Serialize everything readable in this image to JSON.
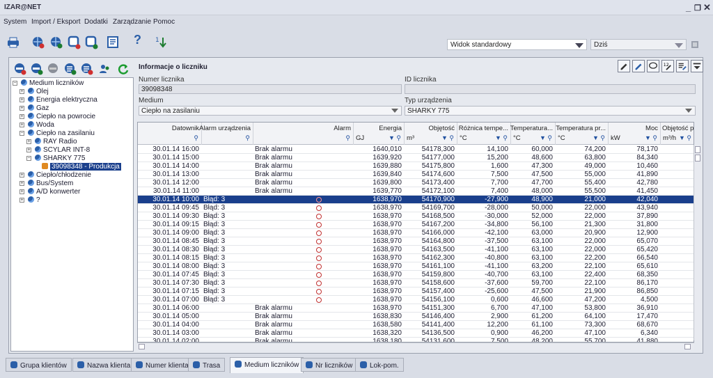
{
  "window": {
    "title": "IZAR@NET"
  },
  "menu": [
    "System",
    "Import / Eksport",
    "Dodatki",
    "Zarządzanie",
    "Pomoc"
  ],
  "toolbar": {
    "view_combo": "Widok standardowy",
    "date_combo": "Dziś",
    "icons": [
      "printer-icon",
      "globe-add-icon",
      "globe-refresh-icon",
      "device-add-icon",
      "device-edit-icon",
      "checklist-icon",
      "help-icon",
      "sort-icon"
    ]
  },
  "tree": {
    "nodes": [
      {
        "label": "Medium liczników",
        "level": 0,
        "expanded": true
      },
      {
        "label": "Olej",
        "level": 1,
        "expanded": false
      },
      {
        "label": "Energia elektryczna",
        "level": 1,
        "expanded": false
      },
      {
        "label": "Gaz",
        "level": 1,
        "expanded": false
      },
      {
        "label": "Ciepło na powrocie",
        "level": 1,
        "expanded": false
      },
      {
        "label": "Woda",
        "level": 1,
        "expanded": false
      },
      {
        "label": "Ciepło na zasilaniu",
        "level": 1,
        "expanded": true
      },
      {
        "label": "RAY Radio",
        "level": 2,
        "expanded": false
      },
      {
        "label": "SCYLAR INT-8",
        "level": 2,
        "expanded": false
      },
      {
        "label": "SHARKY 775",
        "level": 2,
        "expanded": true
      },
      {
        "label": "39098348 - Produkcja",
        "level": 3,
        "selected": true
      },
      {
        "label": "Ciepło/chłodzenie",
        "level": 1,
        "expanded": false
      },
      {
        "label": "Bus/System",
        "level": 1,
        "expanded": false
      },
      {
        "label": "A/D konwerter",
        "level": 1,
        "expanded": false
      },
      {
        "label": "?",
        "level": 1,
        "expanded": false
      }
    ]
  },
  "info": {
    "title": "Informacje o liczniku",
    "meter_number_label": "Numer licznika",
    "meter_number_value": "39098348",
    "meter_id_label": "ID licznika",
    "meter_id_value": "",
    "medium_label": "Medium",
    "medium_value": "Ciepło na zasilaniu",
    "device_type_label": "Typ urządzenia",
    "device_type_value": "SHARKY 775"
  },
  "grid": {
    "columns": [
      {
        "title": "Datownik",
        "unit": ""
      },
      {
        "title": "Alarm urządzenia",
        "unit": ""
      },
      {
        "title": "Alarm",
        "unit": ""
      },
      {
        "title": "Energia",
        "unit": "GJ"
      },
      {
        "title": "Objętość",
        "unit": "m³"
      },
      {
        "title": "Różnica tempe...",
        "unit": "°C"
      },
      {
        "title": "Temperatura...",
        "unit": "°C"
      },
      {
        "title": "Temperatura pr...",
        "unit": "°C"
      },
      {
        "title": "Moc",
        "unit": "kW"
      },
      {
        "title": "Objętość pr",
        "unit": "m³/h"
      }
    ],
    "rows": [
      [
        "30.01.14 16:00",
        "",
        "Brak alarmu",
        "1640,010",
        "54178,300",
        "14,100",
        "60,000",
        "74,200",
        "78,170"
      ],
      [
        "30.01.14 15:00",
        "",
        "Brak alarmu",
        "1639,920",
        "54177,000",
        "15,200",
        "48,600",
        "63,800",
        "84,340"
      ],
      [
        "30.01.14 14:00",
        "",
        "Brak alarmu",
        "1639,880",
        "54175,800",
        "1,600",
        "47,300",
        "49,000",
        "10,460"
      ],
      [
        "30.01.14 13:00",
        "",
        "Brak alarmu",
        "1639,840",
        "54174,600",
        "7,500",
        "47,500",
        "55,000",
        "41,890"
      ],
      [
        "30.01.14 12:00",
        "",
        "Brak alarmu",
        "1639,800",
        "54173,400",
        "7,700",
        "47,700",
        "55,400",
        "42,780"
      ],
      [
        "30.01.14 11:00",
        "",
        "Brak alarmu",
        "1639,770",
        "54172,100",
        "7,400",
        "48,000",
        "55,500",
        "41,450"
      ],
      [
        "30.01.14 10:00",
        "Błąd: 3",
        "",
        "1638,970",
        "54170,900",
        "-27,900",
        "48,900",
        "21,000",
        "42,040"
      ],
      [
        "30.01.14 09:45",
        "Błąd: 3",
        "",
        "1638,970",
        "54169,700",
        "-28,000",
        "50,000",
        "22,000",
        "43,940"
      ],
      [
        "30.01.14 09:30",
        "Błąd: 3",
        "",
        "1638,970",
        "54168,500",
        "-30,000",
        "52,000",
        "22,000",
        "37,890"
      ],
      [
        "30.01.14 09:15",
        "Błąd: 3",
        "",
        "1638,970",
        "54167,200",
        "-34,800",
        "56,100",
        "21,300",
        "31,800"
      ],
      [
        "30.01.14 09:00",
        "Błąd: 3",
        "",
        "1638,970",
        "54166,000",
        "-42,100",
        "63,000",
        "20,900",
        "12,900"
      ],
      [
        "30.01.14 08:45",
        "Błąd: 3",
        "",
        "1638,970",
        "54164,800",
        "-37,500",
        "63,100",
        "22,000",
        "65,070"
      ],
      [
        "30.01.14 08:30",
        "Błąd: 3",
        "",
        "1638,970",
        "54163,500",
        "-41,100",
        "63,100",
        "22,000",
        "65,420"
      ],
      [
        "30.01.14 08:15",
        "Błąd: 3",
        "",
        "1638,970",
        "54162,300",
        "-40,800",
        "63,100",
        "22,200",
        "66,540"
      ],
      [
        "30.01.14 08:00",
        "Błąd: 3",
        "",
        "1638,970",
        "54161,100",
        "-41,100",
        "63,200",
        "22,100",
        "65,610"
      ],
      [
        "30.01.14 07:45",
        "Błąd: 3",
        "",
        "1638,970",
        "54159,800",
        "-40,700",
        "63,100",
        "22,400",
        "68,350"
      ],
      [
        "30.01.14 07:30",
        "Błąd: 3",
        "",
        "1638,970",
        "54158,600",
        "-37,600",
        "59,700",
        "22,100",
        "86,170"
      ],
      [
        "30.01.14 07:15",
        "Błąd: 3",
        "",
        "1638,970",
        "54157,400",
        "-25,600",
        "47,500",
        "21,900",
        "86,850"
      ],
      [
        "30.01.14 07:00",
        "Błąd: 3",
        "",
        "1638,970",
        "54156,100",
        "0,600",
        "46,600",
        "47,200",
        "4,500"
      ],
      [
        "30.01.14 06:00",
        "",
        "Brak alarmu",
        "1638,970",
        "54151,300",
        "6,700",
        "47,100",
        "53,800",
        "36,910"
      ],
      [
        "30.01.14 05:00",
        "",
        "Brak alarmu",
        "1638,830",
        "54146,400",
        "2,900",
        "61,200",
        "64,100",
        "17,470"
      ],
      [
        "30.01.14 04:00",
        "",
        "Brak alarmu",
        "1638,580",
        "54141,400",
        "12,200",
        "61,100",
        "73,300",
        "68,670"
      ],
      [
        "30.01.14 03:00",
        "",
        "Brak alarmu",
        "1638,320",
        "54136,500",
        "0,900",
        "46,200",
        "47,100",
        "6,340"
      ],
      [
        "30.01.14 02:00",
        "",
        "Brak alarmu",
        "1638,180",
        "54131,600",
        "7,500",
        "48,200",
        "55,700",
        "41,880"
      ]
    ],
    "selected_row": 6
  },
  "bottom_tabs": [
    "Grupa klientów",
    "Nazwa klienta",
    "Numer klienta",
    "Trasa",
    "Medium liczników",
    "Nr liczników",
    "Lok-pom."
  ],
  "active_tab": "Medium liczników",
  "colors": {
    "selection": "#1a3f8c",
    "accent": "#2b5fa8",
    "alarm": "#c03030"
  }
}
